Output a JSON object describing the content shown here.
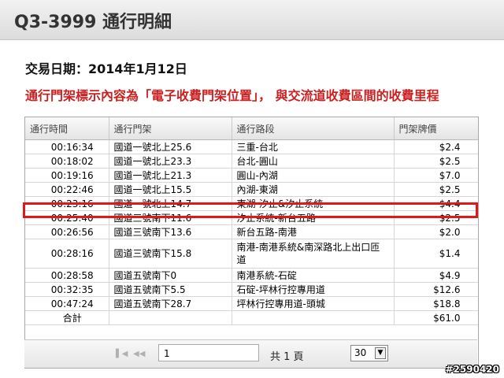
{
  "header": {
    "title": "Q3-3999 通行明細"
  },
  "date_line": "交易日期：2014年1月12日",
  "notice": "通行門架標示內容為「電子收費門架位置」， 與交流道收費區間的收費里程",
  "table": {
    "columns": [
      "通行時間",
      "通行門架",
      "通行路段",
      "門架牌價"
    ],
    "rows": [
      [
        "00:16:34",
        "國道一號北上25.6",
        "三重-台北",
        "$2.4"
      ],
      [
        "00:18:02",
        "國道一號北上23.3",
        "台北-圓山",
        "$2.5"
      ],
      [
        "00:19:16",
        "國道一號北上21.3",
        "圓山-內湖",
        "$7.0"
      ],
      [
        "00:22:46",
        "國道一號北上15.5",
        "內湖-東湖",
        "$2.5"
      ],
      [
        "00:23:16",
        "國道一號北上14.7",
        "東湖-汐止&汐止系統",
        "$4.4"
      ],
      [
        "00:25:40",
        "國道三號南下11.6",
        "汐止系統-新台五路",
        "$2.5"
      ],
      [
        "00:26:56",
        "國道三號南下13.6",
        "新台五路-南港",
        "$2.0"
      ],
      [
        "00:28:16",
        "國道三號南下15.8",
        "南港-南港系統&南深路北上出口匝道",
        "$1.4"
      ],
      [
        "00:28:58",
        "國道五號南下0",
        "南港系統-石碇",
        "$4.9"
      ],
      [
        "00:32:35",
        "國道五號南下5.5",
        "石碇-坪林行控專用道",
        "$12.6"
      ],
      [
        "00:47:24",
        "國道五號南下28.7",
        "坪林行控專用道-頭城",
        "$18.8"
      ]
    ],
    "total_label": "合計",
    "total_value": "$61.0"
  },
  "pager": {
    "page_value": "1",
    "page_text": "共 1 頁",
    "page_size": "30",
    "icons": [
      "first-page-icon",
      "prev-page-icon"
    ]
  },
  "watermark": "#2590420",
  "colors": {
    "notice": "#cc1f1f",
    "highlight": "#e01818"
  }
}
